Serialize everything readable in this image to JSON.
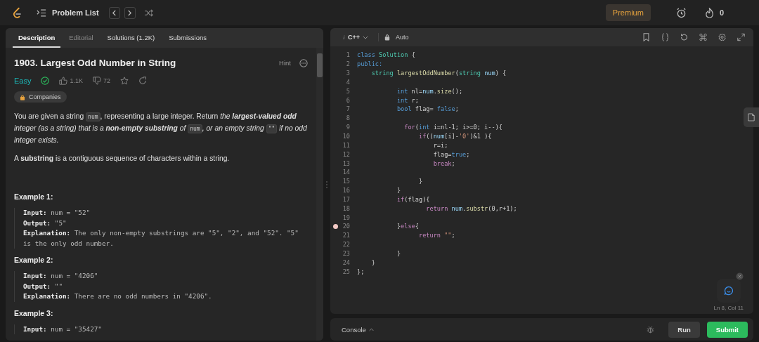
{
  "topbar": {
    "title": "Problem List",
    "premium": "Premium",
    "streak": "0"
  },
  "tabs": [
    {
      "label": "Description",
      "selected": true,
      "disabled": false
    },
    {
      "label": "Editorial",
      "selected": false,
      "disabled": true
    },
    {
      "label": "Solutions (1.2K)",
      "selected": false,
      "disabled": false
    },
    {
      "label": "Submissions",
      "selected": false,
      "disabled": false
    }
  ],
  "problem": {
    "title": "1903. Largest Odd Number in String",
    "hint": "Hint",
    "difficulty": "Easy",
    "solved": true,
    "likes": "1.1K",
    "dislikes": "72",
    "tag": "Companies",
    "paragraphs": [
      [
        {
          "kind": "text",
          "text": "You are given a string "
        },
        {
          "kind": "code",
          "text": "num"
        },
        {
          "kind": "text",
          "text": ", representing a large integer. Return "
        },
        {
          "kind": "em",
          "text": "the **largest-valued odd** integer (as a string) that is a **non-empty substring** of "
        },
        {
          "kind": "code",
          "text": "num"
        },
        {
          "kind": "em",
          "text": ", or an empty string "
        },
        {
          "kind": "code",
          "text": "\"\""
        },
        {
          "kind": "em",
          "text": " if no odd integer exists."
        }
      ],
      [
        {
          "kind": "text",
          "text": "A **substring** is a contiguous sequence of characters within a string."
        }
      ]
    ],
    "examples": [
      {
        "title": "Example 1:",
        "lines": [
          {
            "label": "Input:",
            "value": "num = \"52\""
          },
          {
            "label": "Output:",
            "value": "\"5\""
          },
          {
            "label": "Explanation:",
            "value": "The only non-empty substrings are \"5\", \"2\", and \"52\". \"5\" is the only odd number."
          }
        ]
      },
      {
        "title": "Example 2:",
        "lines": [
          {
            "label": "Input:",
            "value": "num = \"4206\""
          },
          {
            "label": "Output:",
            "value": "\"\""
          },
          {
            "label": "Explanation:",
            "value": "There are no odd numbers in \"4206\"."
          }
        ]
      },
      {
        "title": "Example 3:",
        "lines": [
          {
            "label": "Input:",
            "value": "num = \"35427\""
          }
        ]
      }
    ]
  },
  "editor": {
    "language": "C++",
    "mode": "Auto",
    "cursor": "Ln 8, Col 11",
    "lines": [
      {
        "number": "1",
        "breakpoint": false,
        "tokens": [
          {
            "kind": "kw",
            "text": "class "
          },
          {
            "kind": "type",
            "text": "Solution"
          },
          {
            "kind": "plain",
            "text": " {"
          }
        ]
      },
      {
        "number": "2",
        "breakpoint": false,
        "tokens": [
          {
            "kind": "kw",
            "text": "public:"
          }
        ]
      },
      {
        "number": "3",
        "breakpoint": false,
        "tokens": [
          {
            "kind": "type",
            "text": "    string "
          },
          {
            "kind": "fn",
            "text": "largestOddNumber"
          },
          {
            "kind": "plain",
            "text": "("
          },
          {
            "kind": "type",
            "text": "string "
          },
          {
            "kind": "var",
            "text": "num"
          },
          {
            "kind": "plain",
            "text": ") {"
          }
        ]
      },
      {
        "number": "4",
        "breakpoint": false
      },
      {
        "number": "5",
        "breakpoint": false,
        "tokens": [
          {
            "kind": "kw",
            "text": "           int "
          },
          {
            "kind": "plain",
            "text": "nl="
          },
          {
            "kind": "var",
            "text": "num"
          },
          {
            "kind": "plain",
            "text": "."
          },
          {
            "kind": "fn",
            "text": "size"
          },
          {
            "kind": "plain",
            "text": "();"
          }
        ]
      },
      {
        "number": "6",
        "breakpoint": false,
        "tokens": [
          {
            "kind": "kw",
            "text": "           int "
          },
          {
            "kind": "plain",
            "text": "r;"
          }
        ]
      },
      {
        "number": "7",
        "breakpoint": false,
        "tokens": [
          {
            "kind": "kw",
            "text": "           bool "
          },
          {
            "kind": "plain",
            "text": "flag= "
          },
          {
            "kind": "kw",
            "text": "false"
          },
          {
            "kind": "plain",
            "text": ";"
          }
        ]
      },
      {
        "number": "8",
        "breakpoint": false
      },
      {
        "number": "9",
        "breakpoint": false,
        "tokens": [
          {
            "kind": "ctl",
            "text": "             for"
          },
          {
            "kind": "plain",
            "text": "("
          },
          {
            "kind": "kw",
            "text": "int "
          },
          {
            "kind": "plain",
            "text": "i=nl-1; i>=0; i--){"
          }
        ]
      },
      {
        "number": "10",
        "breakpoint": false,
        "tokens": [
          {
            "kind": "ctl",
            "text": "                 if"
          },
          {
            "kind": "plain",
            "text": "(("
          },
          {
            "kind": "var",
            "text": "num"
          },
          {
            "kind": "plain",
            "text": "[i]-"
          },
          {
            "kind": "str",
            "text": "'0'"
          },
          {
            "kind": "plain",
            "text": ")&1 ){"
          }
        ]
      },
      {
        "number": "11",
        "breakpoint": false,
        "tokens": [
          {
            "kind": "plain",
            "text": "                     r=i;"
          }
        ]
      },
      {
        "number": "12",
        "breakpoint": false,
        "tokens": [
          {
            "kind": "plain",
            "text": "                     flag="
          },
          {
            "kind": "kw",
            "text": "true"
          },
          {
            "kind": "plain",
            "text": ";"
          }
        ]
      },
      {
        "number": "13",
        "breakpoint": false,
        "tokens": [
          {
            "kind": "ctl",
            "text": "                     break"
          },
          {
            "kind": "plain",
            "text": ";"
          }
        ]
      },
      {
        "number": "14",
        "breakpoint": false
      },
      {
        "number": "15",
        "breakpoint": false,
        "tokens": [
          {
            "kind": "plain",
            "text": "                 }"
          }
        ]
      },
      {
        "number": "16",
        "breakpoint": false,
        "tokens": [
          {
            "kind": "plain",
            "text": "           }"
          }
        ]
      },
      {
        "number": "17",
        "breakpoint": false,
        "tokens": [
          {
            "kind": "ctl",
            "text": "           if"
          },
          {
            "kind": "plain",
            "text": "(flag){"
          }
        ]
      },
      {
        "number": "18",
        "breakpoint": false,
        "tokens": [
          {
            "kind": "ctl",
            "text": "                   return "
          },
          {
            "kind": "var",
            "text": "num"
          },
          {
            "kind": "plain",
            "text": "."
          },
          {
            "kind": "fn",
            "text": "substr"
          },
          {
            "kind": "plain",
            "text": "(0,r+1);"
          }
        ]
      },
      {
        "number": "19",
        "breakpoint": false
      },
      {
        "number": "20",
        "breakpoint": true,
        "tokens": [
          {
            "kind": "plain",
            "text": "           }"
          },
          {
            "kind": "ctl",
            "text": "else"
          },
          {
            "kind": "plain",
            "text": "{"
          }
        ]
      },
      {
        "number": "21",
        "breakpoint": false,
        "tokens": [
          {
            "kind": "ctl",
            "text": "                 return "
          },
          {
            "kind": "str",
            "text": "\"\""
          },
          {
            "kind": "plain",
            "text": ";"
          }
        ]
      },
      {
        "number": "22",
        "breakpoint": false
      },
      {
        "number": "23",
        "breakpoint": false,
        "tokens": [
          {
            "kind": "plain",
            "text": "           }"
          }
        ]
      },
      {
        "number": "24",
        "breakpoint": false,
        "tokens": [
          {
            "kind": "plain",
            "text": "    }"
          }
        ]
      },
      {
        "number": "25",
        "breakpoint": false,
        "tokens": [
          {
            "kind": "plain",
            "text": "};"
          }
        ]
      }
    ]
  },
  "console": {
    "label": "Console",
    "run": "Run",
    "submit": "Submit"
  }
}
